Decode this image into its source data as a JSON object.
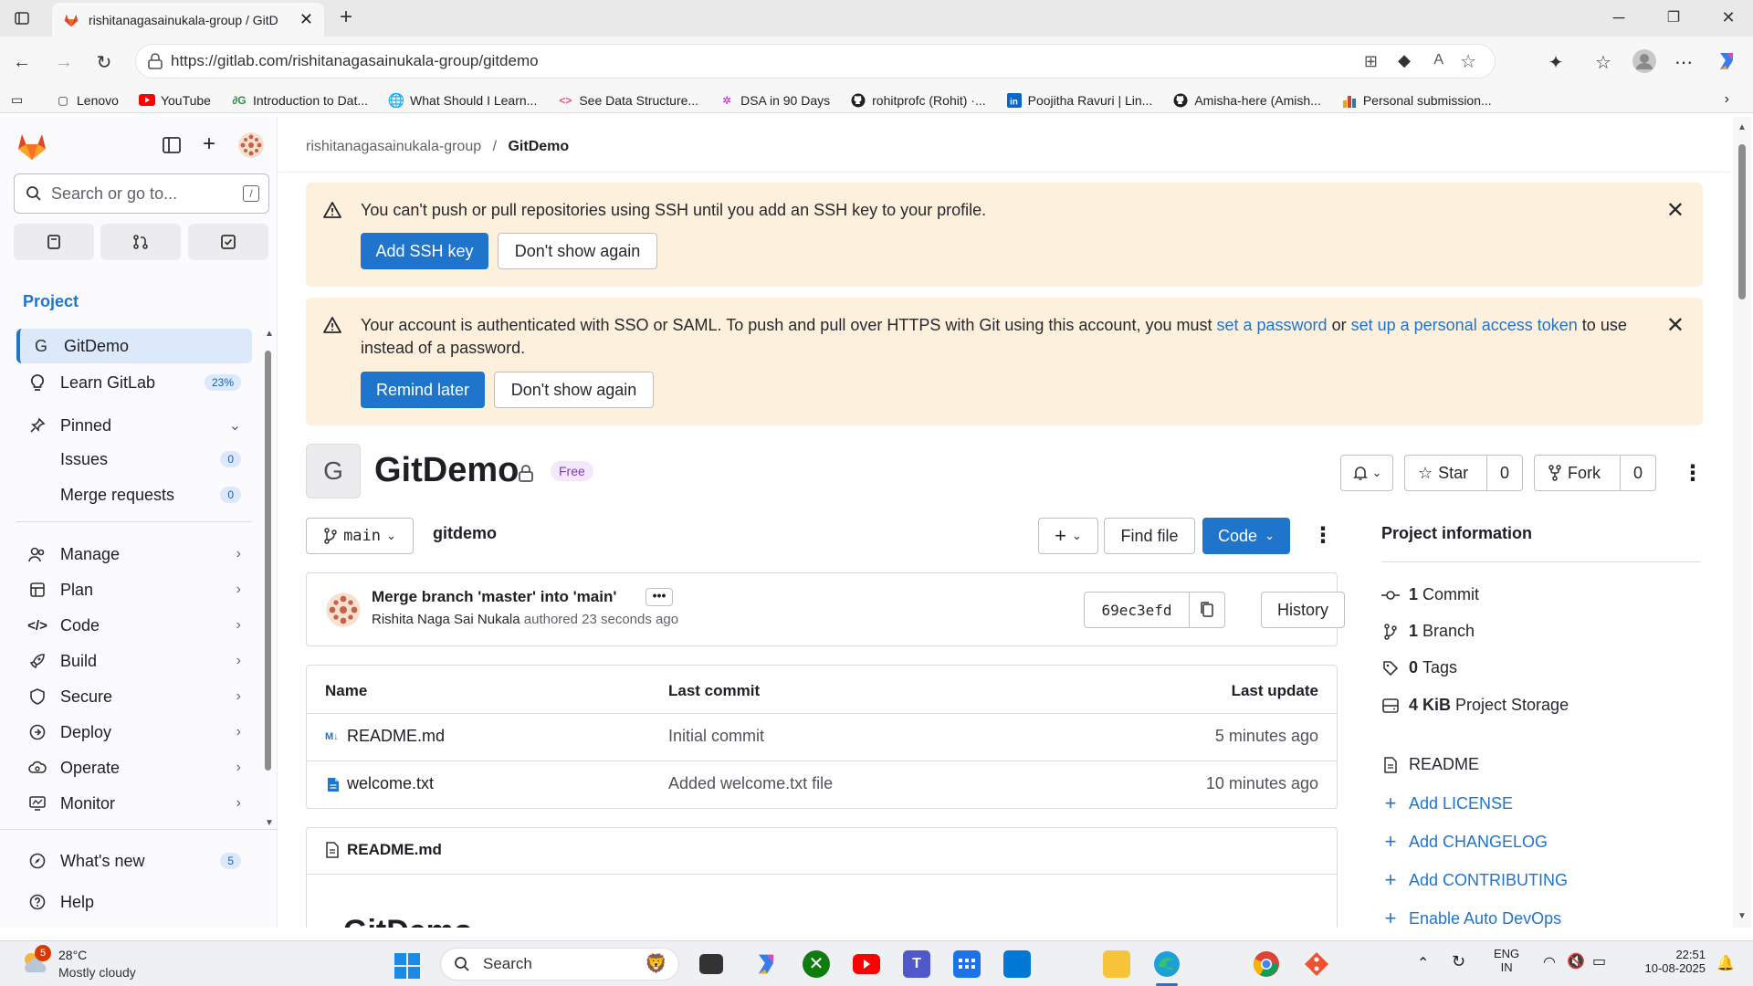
{
  "browser": {
    "tab_title": "rishitanagasainukala-group / GitD",
    "url": "https://gitlab.com/rishitanagasainukala-group/gitdemo",
    "bookmarks": [
      {
        "label": "Lenovo",
        "icon": "folder-icon"
      },
      {
        "label": "YouTube",
        "icon": "youtube-icon"
      },
      {
        "label": "Introduction to Dat...",
        "icon": "gfg-icon"
      },
      {
        "label": "What Should I Learn...",
        "icon": "globe-icon"
      },
      {
        "label": "See Data Structure...",
        "icon": "code-icon"
      },
      {
        "label": "DSA in 90 Days",
        "icon": "dsa-icon"
      },
      {
        "label": "rohitprofc (Rohit) ·...",
        "icon": "github-icon"
      },
      {
        "label": "Poojitha Ravuri | Lin...",
        "icon": "linkedin-icon"
      },
      {
        "label": "Amisha-here (Amish...",
        "icon": "github-icon"
      },
      {
        "label": "Personal submission...",
        "icon": "chart-icon"
      }
    ]
  },
  "sidebar": {
    "search_placeholder": "Search or go to...",
    "section_title": "Project",
    "project_item": "GitDemo",
    "project_letter": "G",
    "learn_label": "Learn GitLab",
    "learn_progress": "23%",
    "pinned_label": "Pinned",
    "pinned_items": [
      {
        "label": "Issues",
        "count": "0"
      },
      {
        "label": "Merge requests",
        "count": "0"
      }
    ],
    "nav_items": [
      "Manage",
      "Plan",
      "Code",
      "Build",
      "Secure",
      "Deploy",
      "Operate",
      "Monitor"
    ],
    "whats_new_label": "What's new",
    "whats_new_count": "5",
    "help_label": "Help"
  },
  "breadcrumb": {
    "group": "rishitanagasainukala-group",
    "separator": "/",
    "project": "GitDemo"
  },
  "alerts": {
    "ssh": {
      "message": "You can't push or pull repositories using SSH until you add an SSH key to your profile.",
      "primary": "Add SSH key",
      "secondary": "Don't show again"
    },
    "sso": {
      "message_1": "Your account is authenticated with SSO or SAML. To push and pull over HTTPS with Git using this account, you must",
      "link_1": "set a password",
      "or": "or",
      "link_2": "set up a personal access token",
      "message_2": "to",
      "message_3": "use instead of a password.",
      "primary": "Remind later",
      "secondary": "Don't show again"
    }
  },
  "project": {
    "letter": "G",
    "title": "GitDemo",
    "badge": "Free",
    "star_label": "Star",
    "star_count": "0",
    "fork_label": "Fork",
    "fork_count": "0",
    "branch": "main",
    "path": "gitdemo",
    "find_file": "Find file",
    "code_label": "Code"
  },
  "commit": {
    "title": "Merge branch 'master' into 'main'",
    "author": "Rishita Naga Sai Nukala",
    "authored": "authored 23 seconds ago",
    "sha": "69ec3efd",
    "history": "History"
  },
  "files": {
    "headers": {
      "name": "Name",
      "last_commit": "Last commit",
      "last_update": "Last update"
    },
    "rows": [
      {
        "name": "README.md",
        "commit": "Initial commit",
        "update": "5 minutes ago"
      },
      {
        "name": "welcome.txt",
        "commit": "Added welcome.txt file",
        "update": "10 minutes ago"
      }
    ]
  },
  "readme": {
    "title": "README.md",
    "heading_peek": "GitDemo"
  },
  "project_info": {
    "title": "Project information",
    "commits_num": "1",
    "commits_label": "Commit",
    "branches_num": "1",
    "branches_label": "Branch",
    "tags_num": "0",
    "tags_label": "Tags",
    "storage_num": "4 KiB",
    "storage_label": "Project Storage",
    "readme": "README",
    "links": [
      "Add LICENSE",
      "Add CHANGELOG",
      "Add CONTRIBUTING",
      "Enable Auto DevOps"
    ]
  },
  "taskbar": {
    "weather_temp": "28°C",
    "weather_desc": "Mostly cloudy",
    "weather_badge": "5",
    "search_label": "Search",
    "lang_1": "ENG",
    "lang_2": "IN",
    "time": "22:51",
    "date": "10-08-2025"
  },
  "colors": {
    "gitlab_blue": "#1f75cb",
    "alert_bg": "#fdf1dd",
    "sidebar_active": "#dbe9fb"
  }
}
